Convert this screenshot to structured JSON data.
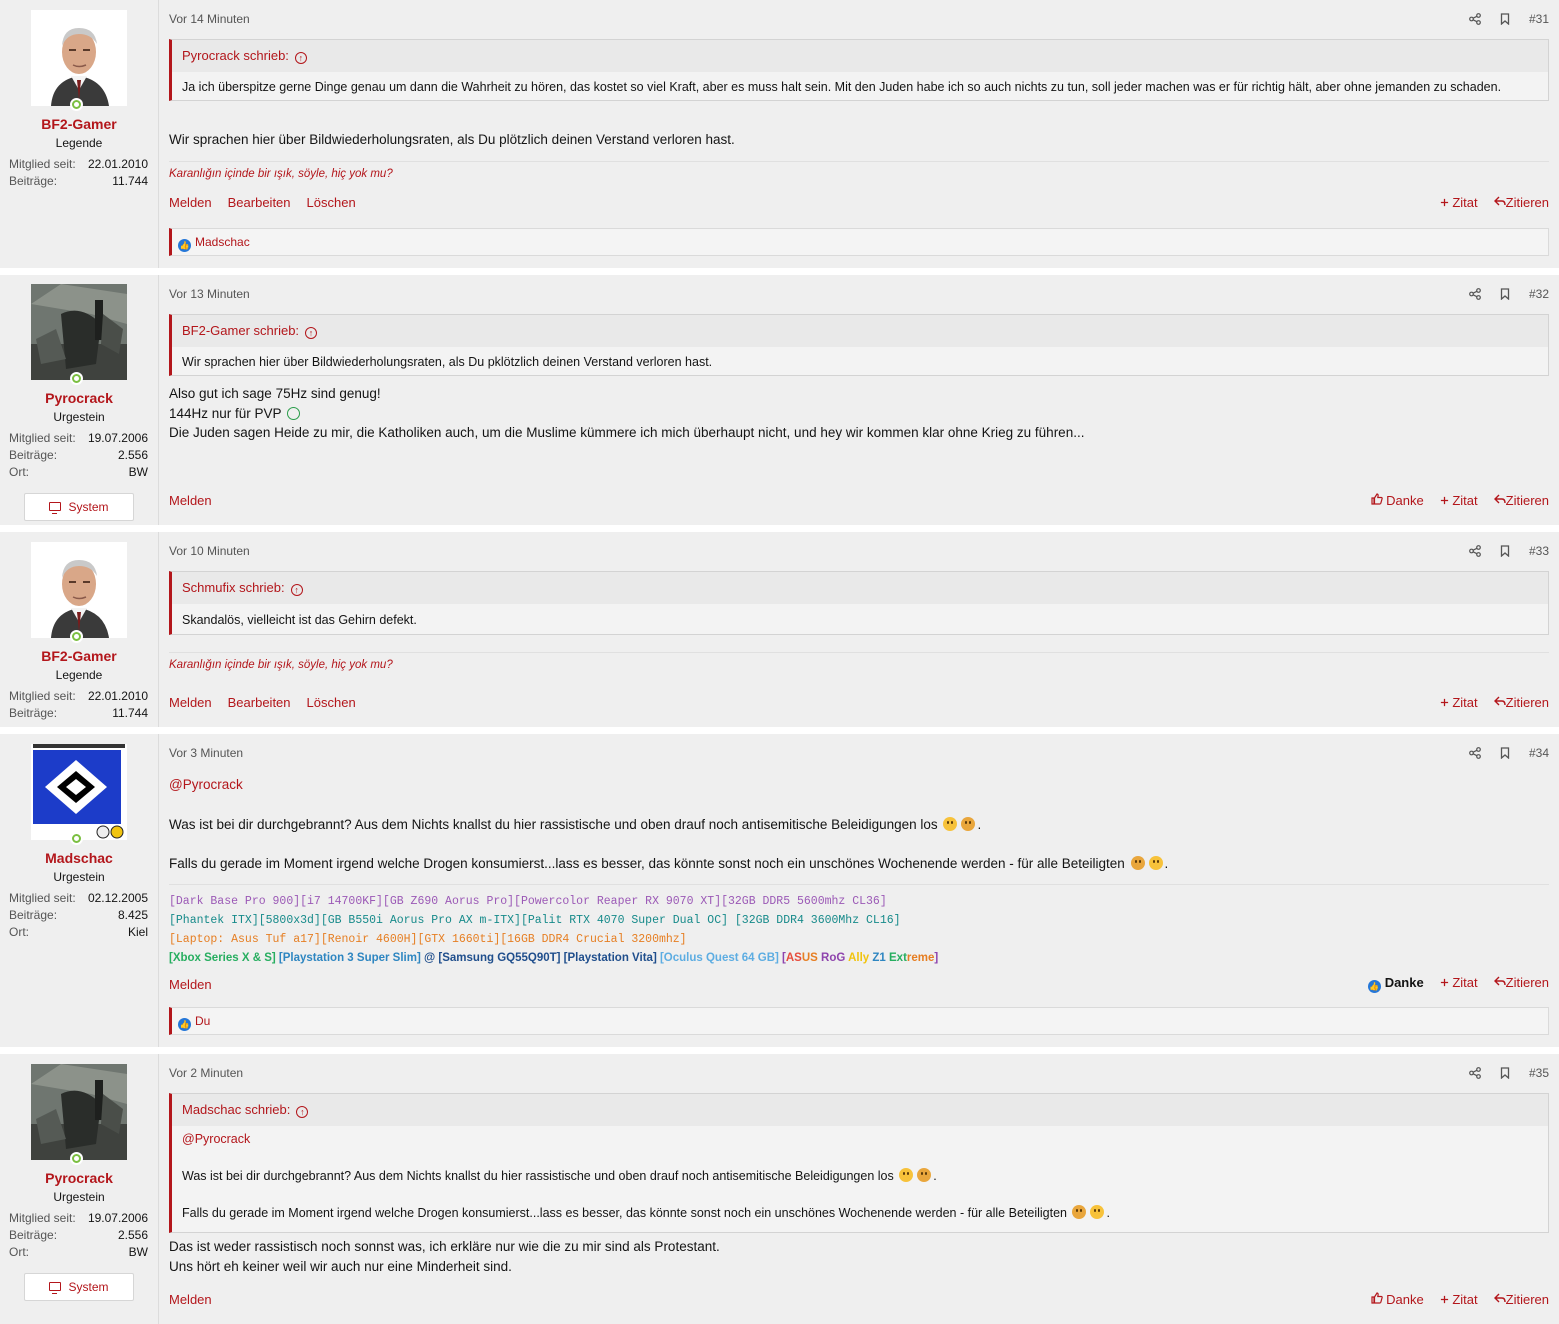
{
  "colors": {
    "accent": "#b3161b",
    "online": "#7bbf41",
    "like": "#2577d8"
  },
  "labels": {
    "report": "Melden",
    "edit": "Bearbeiten",
    "delete": "Löschen",
    "plus_quote": "Zitat",
    "reply_quote": "Zitieren",
    "thanks": "Danke",
    "system": "System",
    "member_since": "Mitglied seit:",
    "posts": "Beiträge:",
    "location": "Ort:"
  },
  "posts": [
    {
      "time": "Vor 14 Minuten",
      "number": "#31",
      "user": {
        "name": "BF2-Gamer",
        "title": "Legende",
        "member_since": "22.01.2010",
        "posts": "11.744"
      },
      "quote": {
        "author": "Pyrocrack schrieb:",
        "text": "Ja ich überspitze gerne Dinge genau um dann die Wahrheit zu hören, das kostet so viel Kraft, aber es muss halt sein. Mit den Juden habe ich so auch nichts zu tun, soll jeder machen was er für richtig hält, aber ohne jemanden zu schaden."
      },
      "message": "Wir sprachen hier über Bildwiederholungsraten, als Du plötzlich deinen Verstand verloren hast.",
      "signature": "Karanlığın içinde bir ışık, söyle, hiç yok mu?",
      "reactions": "Madschac"
    },
    {
      "time": "Vor 13 Minuten",
      "number": "#32",
      "user": {
        "name": "Pyrocrack",
        "title": "Urgestein",
        "member_since": "19.07.2006",
        "posts": "2.556",
        "location": "BW"
      },
      "quote": {
        "author": "BF2-Gamer schrieb:",
        "text": "Wir sprachen hier über Bildwiederholungsraten, als Du pklötzlich deinen Verstand verloren hast."
      },
      "message_lines": [
        "Also gut ich sage 75Hz sind genug!",
        "144Hz nur für PVP",
        "Die Juden sagen Heide zu mir, die Katholiken auch, um die Muslime kümmere ich mich überhaupt nicht, und hey wir kommen klar ohne Krieg zu führen..."
      ]
    },
    {
      "time": "Vor 10 Minuten",
      "number": "#33",
      "user": {
        "name": "BF2-Gamer",
        "title": "Legende",
        "member_since": "22.01.2010",
        "posts": "11.744"
      },
      "quote": {
        "author": "Schmufix schrieb:",
        "text": "Skandalös, vielleicht ist das Gehirn defekt."
      },
      "signature": "Karanlığın içinde bir ışık, söyle, hiç yok mu?"
    },
    {
      "time": "Vor 3 Minuten",
      "number": "#34",
      "user": {
        "name": "Madschac",
        "title": "Urgestein",
        "member_since": "02.12.2005",
        "posts": "8.425",
        "location": "Kiel"
      },
      "mention": "@Pyrocrack",
      "para1": "Was ist bei dir durchgebrannt? Aus dem Nichts knallst du hier rassistische und oben drauf noch antisemitische Beleidigungen los",
      "para2": "Falls du gerade im Moment irgend welche Drogen konsumierst...lass es besser, das könnte sonst noch ein unschönes Wochenende werden - für alle Beteiligten",
      "sig_lines": [
        {
          "text": "[Dark Base Pro 900][i7 14700KF][GB Z690 Aorus Pro][Powercolor Reaper RX 9070 XT][32GB DDR5 5600mhz CL36]",
          "color": "#9b59b6"
        },
        {
          "text": "[Phantek ITX][5800x3d][GB B550i Aorus Pro AX m-ITX][Palit RTX 4070 Super Dual OC] [32GB DDR4 3600Mhz CL16]",
          "color": "#168a8a"
        },
        {
          "text": "[Laptop: Asus Tuf a17][Renoir 4600H][GTX 1660ti][16GB DDR4 Crucial 3200mhz]",
          "color": "#e67e22"
        }
      ],
      "sig_last": [
        {
          "text": "[Xbox Series X & S]",
          "color": "#27ae60"
        },
        {
          "text": " [Playstation 3 Super Slim]",
          "color": "#2e86c1"
        },
        {
          "text": " @ [Samsung GQ55Q90T]",
          "color": "#1f4e8c"
        },
        {
          "text": " [Playstation Vita]",
          "color": "#1f4e8c"
        },
        {
          "text": " [Oculus Quest 64 GB]",
          "color": "#5dade2"
        },
        {
          "text": " [",
          "color": "#8e44ad"
        },
        {
          "text": "AS",
          "color": "#e74c3c"
        },
        {
          "text": "US ",
          "color": "#e67e22"
        },
        {
          "text": "RoG ",
          "color": "#8e44ad"
        },
        {
          "text": "Ally ",
          "color": "#f1c40f"
        },
        {
          "text": "Z1 ",
          "color": "#2e86c1"
        },
        {
          "text": "Ext",
          "color": "#27ae60"
        },
        {
          "text": "reme",
          "color": "#e67e22"
        },
        {
          "text": "]",
          "color": "#8e44ad"
        }
      ],
      "reactions": "Du"
    },
    {
      "time": "Vor 2 Minuten",
      "number": "#35",
      "user": {
        "name": "Pyrocrack",
        "title": "Urgestein",
        "member_since": "19.07.2006",
        "posts": "2.556",
        "location": "BW"
      },
      "quote": {
        "author": "Madschac schrieb:",
        "mention": "@Pyrocrack",
        "para1": "Was ist bei dir durchgebrannt? Aus dem Nichts knallst du hier rassistische und oben drauf noch antisemitische Beleidigungen los",
        "para2": "Falls du gerade im Moment irgend welche Drogen konsumierst...lass es besser, das könnte sonst noch ein unschönes Wochenende werden - für alle Beteiligten"
      },
      "message_lines": [
        "Das ist weder rassistisch noch sonnst was, ich erkläre nur wie die zu mir sind als Protestant.",
        "Uns hört eh keiner weil wir auch nur eine Minderheit sind."
      ]
    }
  ]
}
